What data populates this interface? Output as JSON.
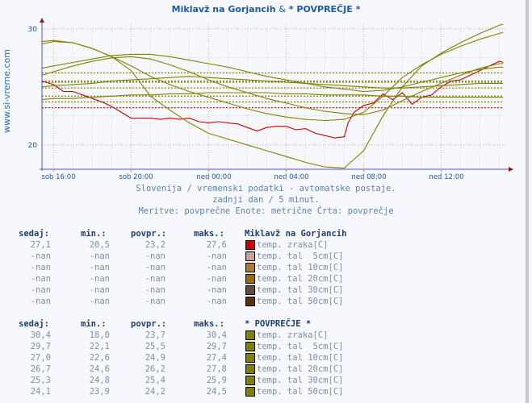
{
  "header": {
    "title_part1": "Miklavž na Gorjancih",
    "title_amp": "&",
    "title_part2": "* POVPREČJE *"
  },
  "watermark": "www.si-vreme.com",
  "subtitle": {
    "line1": "Slovenija / vremenski podatki - avtomatske postaje.",
    "line2": "zadnji dan / 5 minut.",
    "line3": "Meritve: povprečne  Enote: metrične  Črta: povprečje"
  },
  "stats_headers": {
    "sedaj": "sedaj:",
    "min": "min.:",
    "povpr": "povpr.:",
    "maks": "maks.:"
  },
  "station_block": {
    "name": "Miklavž na Gorjancih",
    "rows": [
      {
        "sedaj": "27,1",
        "min": "20,5",
        "povpr": "23,2",
        "maks": "27,6",
        "label": "temp. zraka[C]",
        "color": "#cc0000"
      },
      {
        "sedaj": "-nan",
        "min": "-nan",
        "povpr": "-nan",
        "maks": "-nan",
        "label": "temp. tal  5cm[C]",
        "color": "#c8a0a0"
      },
      {
        "sedaj": "-nan",
        "min": "-nan",
        "povpr": "-nan",
        "maks": "-nan",
        "label": "temp. tal 10cm[C]",
        "color": "#b07830"
      },
      {
        "sedaj": "-nan",
        "min": "-nan",
        "povpr": "-nan",
        "maks": "-nan",
        "label": "temp. tal 20cm[C]",
        "color": "#a06800"
      },
      {
        "sedaj": "-nan",
        "min": "-nan",
        "povpr": "-nan",
        "maks": "-nan",
        "label": "temp. tal 30cm[C]",
        "color": "#605038"
      },
      {
        "sedaj": "-nan",
        "min": "-nan",
        "povpr": "-nan",
        "maks": "-nan",
        "label": "temp. tal 50cm[C]",
        "color": "#603000"
      }
    ]
  },
  "average_block": {
    "name": "* POVPREČJE *",
    "rows": [
      {
        "sedaj": "30,4",
        "min": "18,0",
        "povpr": "23,7",
        "maks": "30,4",
        "label": "temp. zraka[C]",
        "color": "#808000"
      },
      {
        "sedaj": "29,7",
        "min": "22,1",
        "povpr": "25,5",
        "maks": "29,7",
        "label": "temp. tal  5cm[C]",
        "color": "#808000"
      },
      {
        "sedaj": "27,0",
        "min": "22,6",
        "povpr": "24,9",
        "maks": "27,4",
        "label": "temp. tal 10cm[C]",
        "color": "#808000"
      },
      {
        "sedaj": "26,7",
        "min": "24,6",
        "povpr": "26,2",
        "maks": "27,8",
        "label": "temp. tal 20cm[C]",
        "color": "#808000"
      },
      {
        "sedaj": "25,3",
        "min": "24,8",
        "povpr": "25,4",
        "maks": "25,9",
        "label": "temp. tal 30cm[C]",
        "color": "#808000"
      },
      {
        "sedaj": "24,1",
        "min": "23,9",
        "povpr": "24,2",
        "maks": "24,5",
        "label": "temp. tal 50cm[C]",
        "color": "#808000"
      }
    ]
  },
  "chart_data": {
    "type": "line",
    "title": "Miklavž na Gorjancih & * POVPREČJE *",
    "xlabel": "",
    "ylabel": "",
    "x_hours": [
      0,
      1,
      2,
      3,
      4,
      5,
      6,
      7,
      8,
      9,
      10,
      11,
      12,
      13,
      14,
      15,
      16,
      17,
      18,
      19,
      20,
      21,
      22,
      23,
      24
    ],
    "x_range_hours": [
      -0.6,
      23.4
    ],
    "x_ticks": [
      {
        "hour": 0,
        "label": "sob 16:00"
      },
      {
        "hour": 4,
        "label": "sob 20:00"
      },
      {
        "hour": 8,
        "label": "ned 00:00"
      },
      {
        "hour": 12,
        "label": "ned 04:00"
      },
      {
        "hour": 16,
        "label": "ned 08:00"
      },
      {
        "hour": 20,
        "label": "ned 12:00"
      }
    ],
    "y_ticks": [
      20,
      30
    ],
    "ylim": [
      17.9,
      30.4
    ],
    "grid": true,
    "series": [
      {
        "name": "Miklavž na Gorjancih - temp. zraka[C]",
        "color": "#cc0000",
        "avg": 23.2,
        "x": [
          -0.6,
          0,
          0.5,
          1,
          1.5,
          2,
          2.5,
          3,
          3.5,
          4,
          4.5,
          5,
          5.5,
          6,
          6.5,
          7,
          7.5,
          8,
          8.5,
          9,
          9.5,
          10,
          10.5,
          11,
          11.5,
          12,
          12.5,
          13,
          13.5,
          14,
          14.5,
          15,
          15.2,
          15.5,
          16,
          16.5,
          17,
          17.5,
          18,
          18.5,
          19,
          19.5,
          20,
          20.5,
          21,
          21.5,
          22,
          22.5,
          23,
          23.2
        ],
        "values": [
          25.5,
          25.2,
          24.6,
          24.6,
          24.3,
          24.0,
          23.7,
          23.3,
          22.8,
          22.3,
          22.3,
          22.3,
          22.2,
          22.3,
          22.2,
          22.3,
          22.0,
          21.9,
          22.0,
          21.9,
          21.8,
          21.5,
          21.2,
          21.5,
          21.6,
          21.6,
          21.3,
          21.4,
          21.0,
          20.8,
          20.6,
          20.7,
          21.9,
          22.8,
          23.4,
          23.6,
          24.4,
          23.9,
          24.5,
          23.5,
          24.1,
          24.3,
          25.0,
          25.5,
          25.6,
          26.0,
          26.4,
          26.8,
          27.2,
          27.1
        ]
      },
      {
        "name": "POVPREČJE - temp. zraka[C]",
        "color": "#808000",
        "avg": 23.7,
        "x": [
          -0.6,
          0,
          1,
          2,
          3,
          4,
          5,
          6,
          7,
          8,
          9,
          10,
          11,
          12,
          13,
          14,
          15,
          16,
          17,
          18,
          19,
          20,
          21,
          22,
          23,
          23.2
        ],
        "values": [
          28.7,
          28.9,
          28.8,
          28.3,
          27.6,
          26.4,
          24.2,
          23.0,
          21.9,
          21.0,
          20.5,
          20.0,
          19.5,
          19.0,
          18.5,
          18.1,
          18.0,
          19.5,
          22.5,
          25.0,
          26.8,
          27.9,
          28.8,
          29.6,
          30.3,
          30.4
        ]
      },
      {
        "name": "POVPREČJE - temp. tal  5cm[C]",
        "color": "#808000",
        "avg": 25.5,
        "x": [
          -0.6,
          0,
          1,
          2,
          3,
          4,
          5,
          6,
          7,
          8,
          9,
          10,
          11,
          12,
          13,
          14,
          15,
          16,
          17,
          18,
          19,
          20,
          21,
          22,
          23,
          23.2
        ],
        "values": [
          28.9,
          29.0,
          28.8,
          28.3,
          27.6,
          26.8,
          25.9,
          25.2,
          24.6,
          24.1,
          23.6,
          23.1,
          22.7,
          22.4,
          22.2,
          22.1,
          22.2,
          22.8,
          24.2,
          25.8,
          26.9,
          27.8,
          28.5,
          29.1,
          29.6,
          29.7
        ]
      },
      {
        "name": "POVPREČJE - temp. tal 10cm[C]",
        "color": "#808000",
        "avg": 24.9,
        "x": [
          -0.6,
          0,
          1,
          2,
          3,
          4,
          5,
          6,
          7,
          8,
          9,
          10,
          11,
          12,
          13,
          14,
          15,
          16,
          17,
          18,
          19,
          20,
          21,
          22,
          23,
          23.2
        ],
        "values": [
          26.0,
          26.3,
          26.8,
          27.2,
          27.5,
          27.6,
          27.4,
          26.9,
          26.3,
          25.6,
          25.0,
          24.5,
          24.0,
          23.6,
          23.2,
          22.9,
          22.7,
          22.6,
          23.0,
          23.8,
          24.6,
          25.3,
          26.0,
          26.6,
          27.0,
          27.0
        ]
      },
      {
        "name": "POVPREČJE - temp. tal 20cm[C]",
        "color": "#808000",
        "avg": 26.2,
        "x": [
          -0.6,
          0,
          1,
          2,
          3,
          4,
          5,
          6,
          7,
          8,
          9,
          10,
          11,
          12,
          13,
          14,
          15,
          16,
          17,
          18,
          19,
          20,
          21,
          22,
          23,
          23.2
        ],
        "values": [
          26.6,
          26.8,
          27.1,
          27.4,
          27.7,
          27.8,
          27.8,
          27.6,
          27.3,
          27.0,
          26.7,
          26.3,
          25.9,
          25.6,
          25.3,
          25.0,
          24.8,
          24.6,
          24.7,
          25.0,
          25.4,
          25.8,
          26.2,
          26.5,
          26.7,
          26.7
        ]
      },
      {
        "name": "POVPREČJE - temp. tal 30cm[C]",
        "color": "#808000",
        "avg": 25.4,
        "x": [
          -0.6,
          0,
          1,
          2,
          3,
          4,
          5,
          6,
          7,
          8,
          9,
          10,
          11,
          12,
          13,
          14,
          15,
          16,
          17,
          18,
          19,
          20,
          21,
          22,
          23,
          23.2
        ],
        "values": [
          25.0,
          25.1,
          25.2,
          25.3,
          25.5,
          25.6,
          25.7,
          25.8,
          25.9,
          25.8,
          25.7,
          25.6,
          25.5,
          25.4,
          25.3,
          25.2,
          25.1,
          25.0,
          24.9,
          24.9,
          25.0,
          25.1,
          25.2,
          25.3,
          25.3,
          25.3
        ]
      },
      {
        "name": "POVPREČJE - temp. tal 50cm[C]",
        "color": "#808000",
        "avg": 24.2,
        "x": [
          -0.6,
          0,
          1,
          2,
          3,
          4,
          5,
          6,
          7,
          8,
          9,
          10,
          11,
          12,
          13,
          14,
          15,
          16,
          17,
          18,
          19,
          20,
          21,
          22,
          23,
          23.2
        ],
        "values": [
          23.9,
          24.0,
          24.0,
          24.1,
          24.2,
          24.3,
          24.3,
          24.4,
          24.4,
          24.5,
          24.5,
          24.5,
          24.5,
          24.4,
          24.4,
          24.3,
          24.3,
          24.3,
          24.2,
          24.2,
          24.1,
          24.1,
          24.1,
          24.1,
          24.1,
          24.1
        ]
      }
    ]
  }
}
